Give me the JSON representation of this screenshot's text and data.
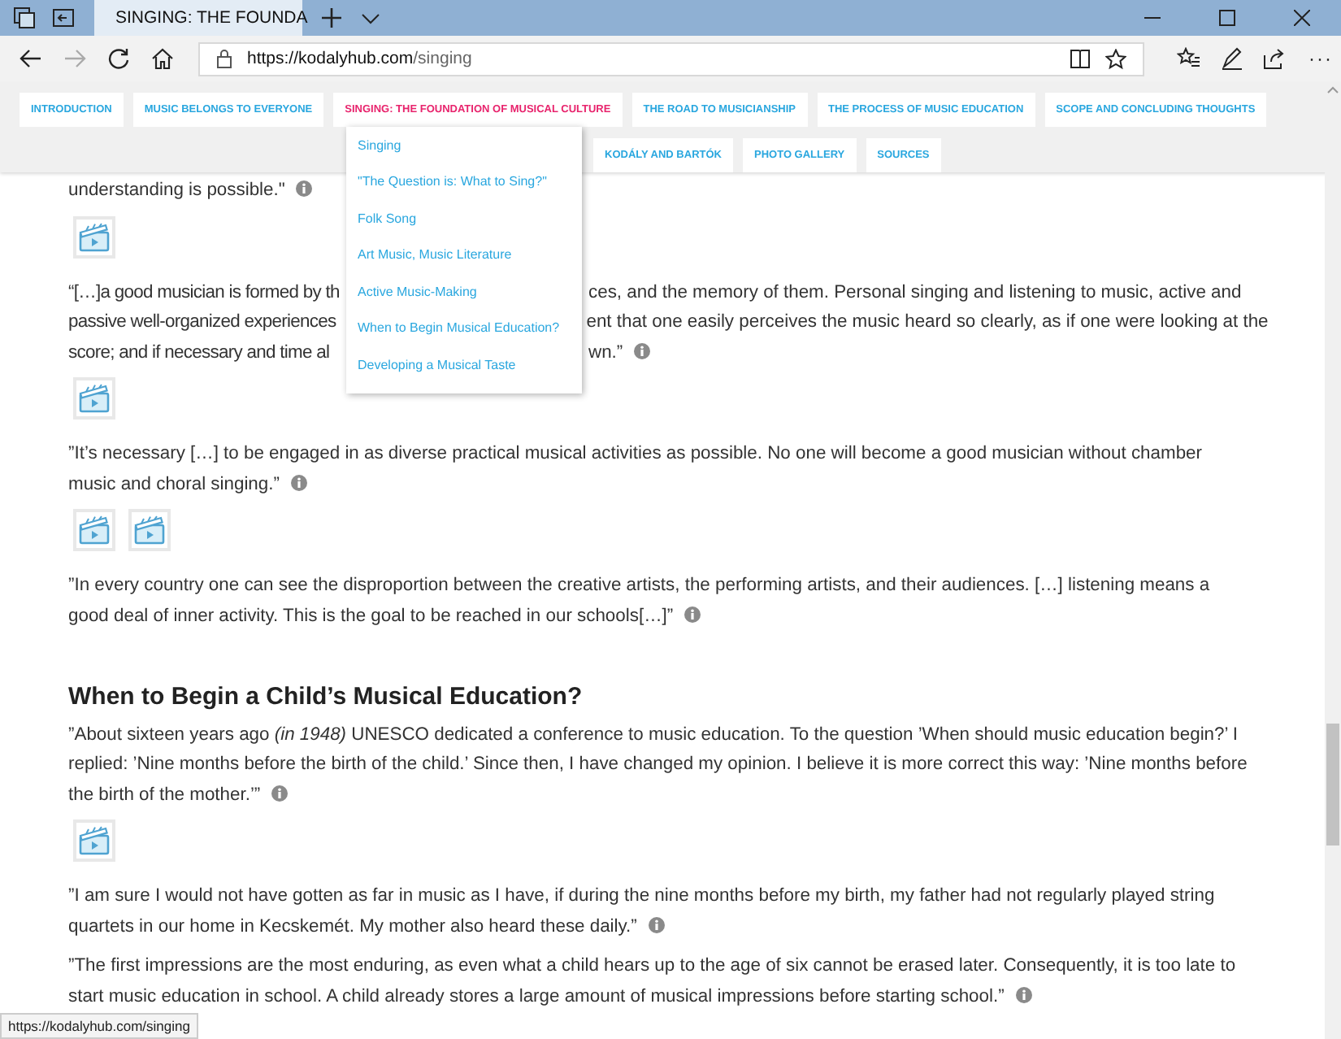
{
  "browser": {
    "tab_title": "SINGING: THE FOUNDA",
    "url_host": "https://kodalyhub.com",
    "url_path": "/singing",
    "more": "···"
  },
  "nav": {
    "rows": [
      {
        "items": [
          {
            "label": "INTRODUCTION",
            "selected": false
          },
          {
            "label": "MUSIC BELONGS TO EVERYONE",
            "selected": false
          },
          {
            "label": "SINGING: THE FOUNDATION OF MUSICAL CULTURE",
            "selected": true
          },
          {
            "label": "THE ROAD TO MUSICIANSHIP",
            "selected": false
          },
          {
            "label": "THE PROCESS OF MUSIC EDUCATION",
            "selected": false
          },
          {
            "label": "SCOPE AND CONCLUDING THOUGHTS",
            "selected": false
          }
        ]
      },
      {
        "items": [
          {
            "label": "KODÁLY AND BARTÓK",
            "selected": false
          },
          {
            "label": "PHOTO GALLERY",
            "selected": false
          },
          {
            "label": "SOURCES",
            "selected": false
          }
        ]
      }
    ]
  },
  "dropdown": {
    "items": [
      "Singing",
      "\"The Question is: What to Sing?\"",
      "Folk Song",
      "Art Music, Music Literature",
      "Active Music-Making",
      "When to Begin Musical Education?",
      "Developing a Musical Taste"
    ]
  },
  "content": [
    {
      "kind": "paragraph",
      "text": "understanding is possible.\""
    },
    {
      "kind": "videos",
      "items": [
        {
          "kind": "video"
        }
      ]
    },
    {
      "kind": "covered_paragraph",
      "lines": [
        {
          "left": "“[…]a good musician is formed by th",
          "right": "ces, and the memory of them. Personal singing and listening to music, active and"
        },
        {
          "left": "passive well-organized experiences",
          "right": "ent that one easily perceives the music heard so clearly, as if one were looking at the"
        },
        {
          "left": "score; and if necessary and time al",
          "right": "wn.”"
        }
      ]
    },
    {
      "kind": "videos",
      "items": [
        {
          "kind": "video"
        }
      ]
    },
    {
      "kind": "paragraph",
      "text": "”It’s necessary […] to be engaged in as diverse practical musical activities as possible. No one will become a good musician without chamber music and choral singing.”"
    },
    {
      "kind": "videos",
      "items": [
        {
          "kind": "video"
        },
        {
          "kind": "video"
        }
      ]
    },
    {
      "kind": "paragraph",
      "text": "”In every country one can see the disproportion between the creative artists, the performing artists, and their audiences. […] listening means a good deal of inner activity. This is the goal to be reached in our schools[…]”"
    },
    {
      "kind": "heading",
      "text": "When to Begin a Child’s Musical Education?"
    },
    {
      "kind": "paragraph",
      "text": "”About sixteen years ago *(in 1948)* UNESCO dedicated a conference to music education. To the question ’When should music education begin?’ I replied: ’Nine months before the birth of the child.’ Since then, I have changed my opinion. I believe it is more correct this way: ’Nine months before the birth of the mother.’”"
    },
    {
      "kind": "videos",
      "items": [
        {
          "kind": "video"
        }
      ]
    },
    {
      "kind": "paragraph",
      "text": "”I am sure I would not have gotten as far in music as I have, if during the nine months before my birth, my father had not regularly played string quartets in our home in Kecskemét. My mother also heard these daily.”"
    },
    {
      "kind": "paragraph",
      "text": "”The first impressions are the most enduring, as even what a child hears up to the age of six cannot be erased later. Consequently, it is too late to start music education in school. A child already stores a large amount of musical impressions before starting school.”"
    }
  ],
  "status_url": "https://kodalyhub.com/singing"
}
